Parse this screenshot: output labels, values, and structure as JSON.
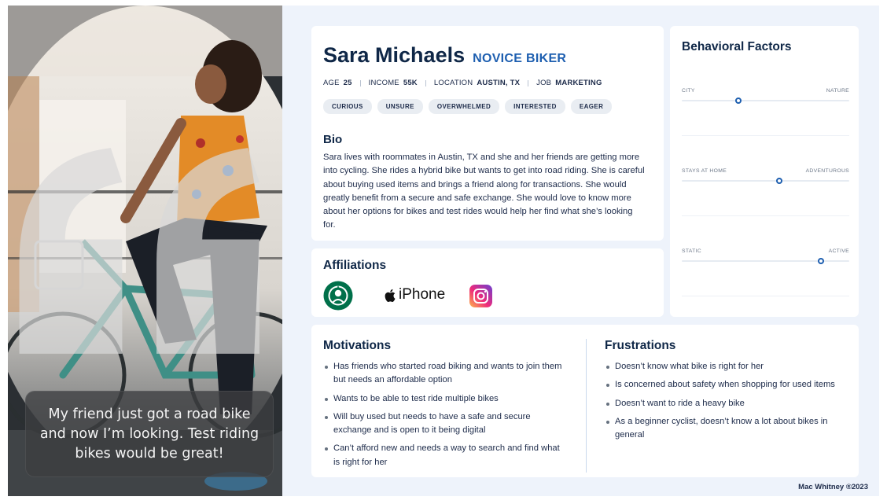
{
  "quote": "My friend just got a road bike and now I’m looking. Test riding bikes would be great!",
  "profile": {
    "name": "Sara Michaels",
    "role": "NOVICE BIKER",
    "meta": [
      {
        "key": "AGE",
        "value": "25"
      },
      {
        "key": "INCOME",
        "value": "55K"
      },
      {
        "key": "LOCATION",
        "value": "AUSTIN, TX"
      },
      {
        "key": "JOB",
        "value": "MARKETING"
      }
    ],
    "tags": [
      "CURIOUS",
      "UNSURE",
      "OVERWHELMED",
      "INTERESTED",
      "EAGER"
    ],
    "bio_heading": "Bio",
    "bio": "Sara lives with roommates in Austin, TX and she and her friends are getting more into cycling. She rides a hybrid bike but wants to get into road riding. She is careful about buying used items and brings a friend along for transactions. She would greatly benefit from a secure and safe exchange. She would love to know more about her options for bikes and test rides would help her find what she’s looking for."
  },
  "affiliations": {
    "heading": "Affiliations",
    "logos": [
      "starbucks-logo",
      "iphone-logo",
      "instagram-logo"
    ],
    "iphone_text": "iPhone"
  },
  "behavioral": {
    "heading": "Behavioral Factors",
    "sliders": [
      {
        "left": "CITY",
        "right": "NATURE",
        "level": 0.34
      },
      {
        "left": "STAYS AT HOME",
        "right": "ADVENTUROUS",
        "level": 0.58
      },
      {
        "left": "STATIC",
        "right": "ACTIVE",
        "level": 0.83
      }
    ]
  },
  "motivations": {
    "heading": "Motivations",
    "items": [
      "Has friends who started road biking and wants to join them but needs an affordable option",
      "Wants to be able to test ride multiple bikes",
      "Will buy used but needs to have a safe and secure exchange and is open to it being digital",
      "Can’t afford new and needs a way to search and find what is right for her"
    ]
  },
  "frustrations": {
    "heading": "Frustrations",
    "items": [
      "Doesn’t know what bike is right for her",
      "Is concerned about safety when shopping for used items",
      "Doesn’t want to ride a heavy bike",
      "As a beginner cyclist, doesn’t know a lot about bikes in general"
    ]
  },
  "credit": "Mac Whitney ®2023",
  "colors": {
    "accent": "#1e5fb0",
    "heading": "#0f2747",
    "background": "#eef3fb"
  }
}
